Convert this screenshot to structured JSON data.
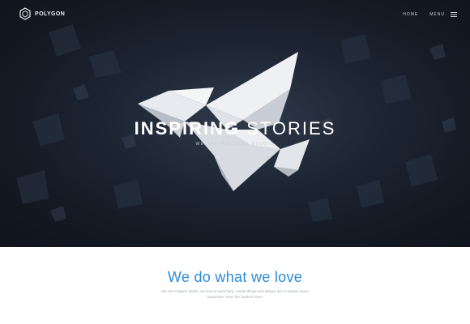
{
  "header": {
    "brand": "POLYGON",
    "nav": {
      "home_label": "HOME",
      "menu_label": "MENU"
    }
  },
  "hero": {
    "title_bold": "INSPIRING",
    "title_light": "STORIES",
    "subtitle": "WE ARE POLYGON STUDIO"
  },
  "intro": {
    "title": "We do what we love",
    "text": "We are Polygon studio, we love to work hard, create things and always aim to please every customers, even the hardest ones."
  },
  "colors": {
    "hero_bg": "#1a2230",
    "accent": "#2c8bd8",
    "body_text": "#a2a9b0"
  },
  "icons": [
    "polygon-logo-icon",
    "hamburger-menu-icon",
    "origami-bird-illustration"
  ]
}
